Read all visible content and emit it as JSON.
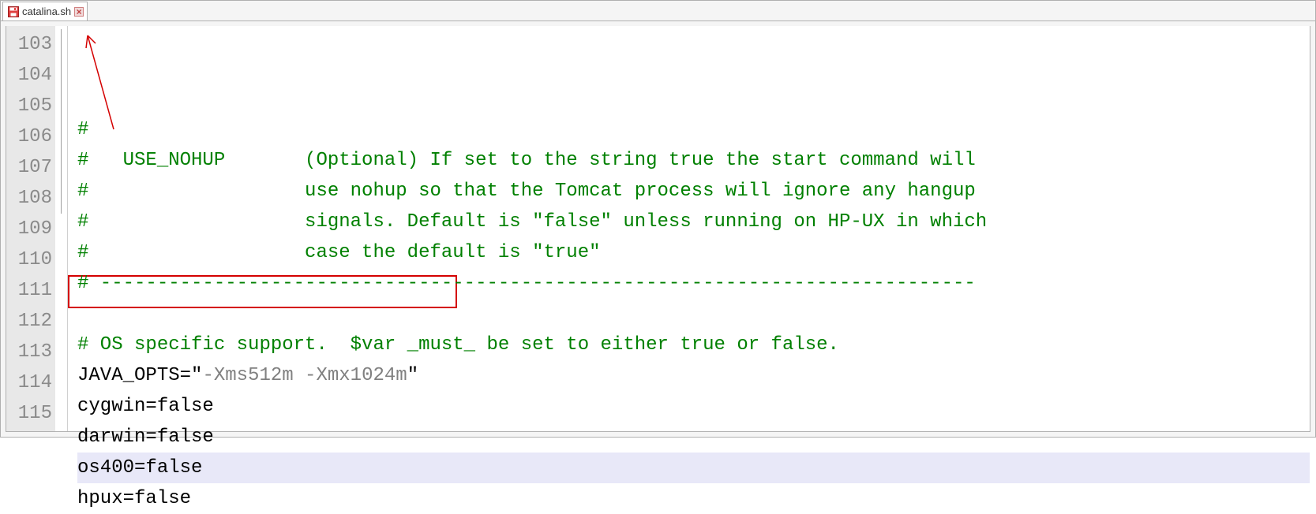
{
  "tab": {
    "filename": "catalina.sh"
  },
  "lines": [
    {
      "num": 103,
      "text": "#"
    },
    {
      "num": 104,
      "text": "#   USE_NOHUP       (Optional) If set to the string true the start command will"
    },
    {
      "num": 105,
      "text": "#                   use nohup so that the Tomcat process will ignore any hangup"
    },
    {
      "num": 106,
      "text": "#                   signals. Default is \"false\" unless running on HP-UX in which"
    },
    {
      "num": 107,
      "text": "#                   case the default is \"true\""
    },
    {
      "num": 108,
      "text": "# -----------------------------------------------------------------------------"
    },
    {
      "num": 109,
      "text": ""
    },
    {
      "num": 110,
      "text": "# OS specific support.  $var _must_ be set to either true or false."
    },
    {
      "num": 111,
      "text_pre": "JAVA_OPTS=\"",
      "text_gray": "-Xms512m -Xmx1024m",
      "text_post": "\""
    },
    {
      "num": 112,
      "text": "cygwin=false"
    },
    {
      "num": 113,
      "text": "darwin=false"
    },
    {
      "num": 114,
      "text": "os400=false"
    },
    {
      "num": 115,
      "text": "hpux=false"
    }
  ],
  "current_line": 114
}
